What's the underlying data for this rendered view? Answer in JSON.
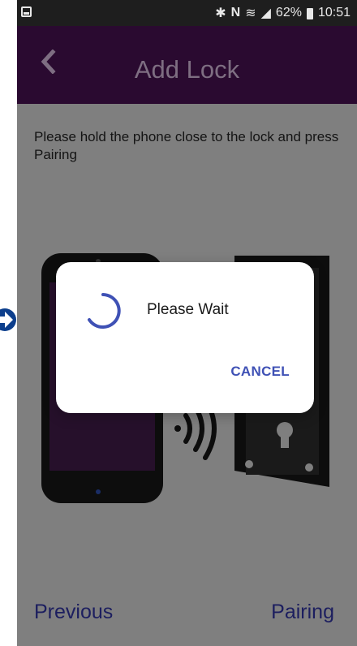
{
  "status_bar": {
    "battery": "62%",
    "time": "10:51"
  },
  "app_bar": {
    "title": "Add Lock"
  },
  "instruction": "Please hold the phone close to the lock and press Pairing",
  "footer": {
    "previous_label": "Previous",
    "pairing_label": "Pairing"
  },
  "dialog": {
    "message": "Please Wait",
    "cancel_label": "CANCEL"
  },
  "colors": {
    "app_bar": "#4a0e55",
    "accent": "#3f51b5",
    "footer_text": "#1c1e5f",
    "dim_overlay": "#7f7f7f"
  }
}
